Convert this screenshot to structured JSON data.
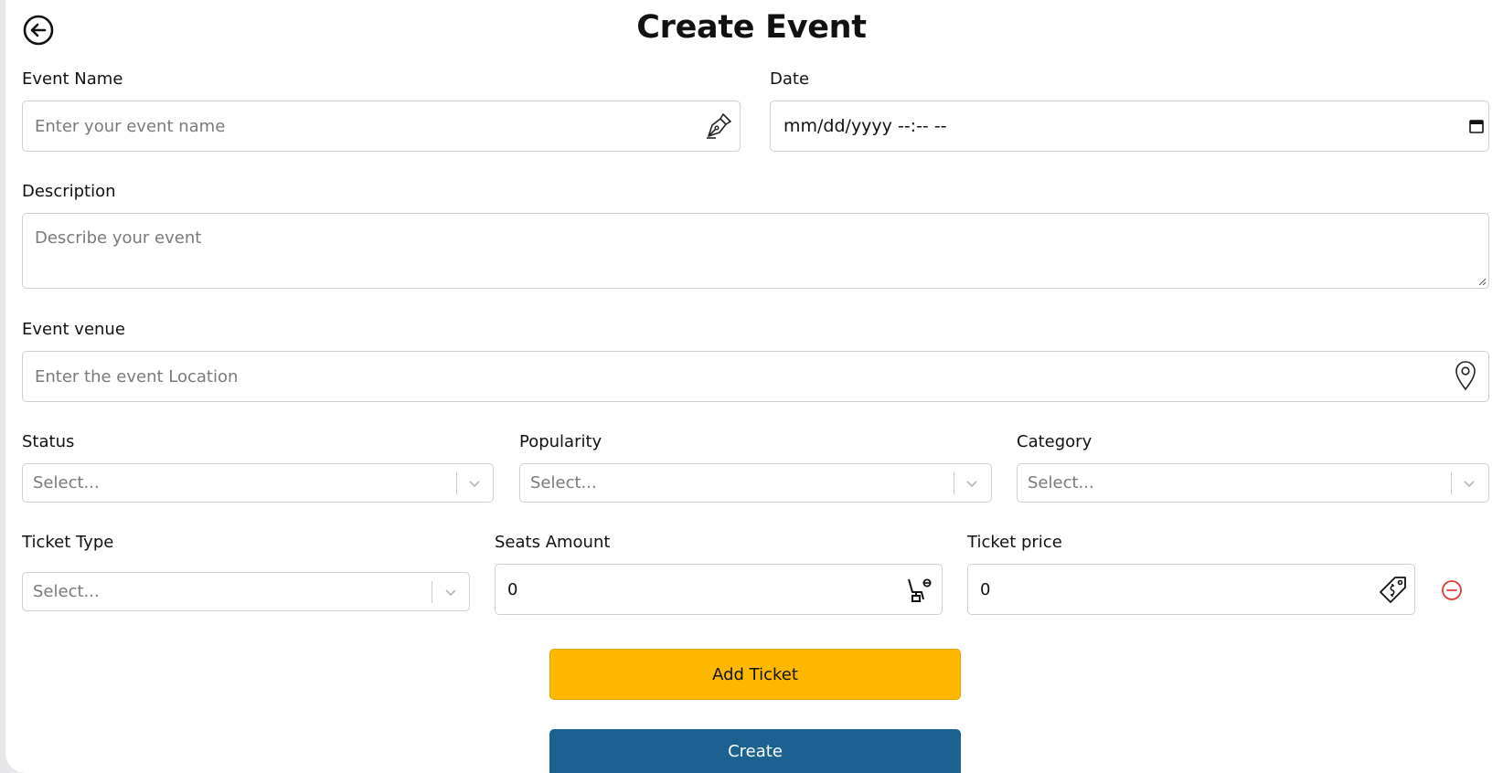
{
  "header": {
    "title": "Create Event"
  },
  "icons": {
    "back": "arrow-left-circle-icon",
    "pen": "fountain-pen-icon",
    "calendar": "calendar-icon",
    "location": "map-pin-icon",
    "seat": "seat-icon",
    "tag": "price-tag-icon",
    "remove": "minus-circle-icon",
    "chevron": "chevron-down-icon"
  },
  "colors": {
    "add_button": "#ffb800",
    "create_button": "#1c6290",
    "remove_icon": "#e53935"
  },
  "form": {
    "event_name": {
      "label": "Event Name",
      "placeholder": "Enter your event name",
      "value": ""
    },
    "date": {
      "label": "Date",
      "value": "mm/dd/yyyy --:-- --"
    },
    "description": {
      "label": "Description",
      "placeholder": "Describe your event",
      "value": ""
    },
    "venue": {
      "label": "Event venue",
      "placeholder": "Enter the event Location",
      "value": ""
    },
    "status": {
      "label": "Status",
      "placeholder": "Select..."
    },
    "popularity": {
      "label": "Popularity",
      "placeholder": "Select..."
    },
    "category": {
      "label": "Category",
      "placeholder": "Select..."
    },
    "ticket_type": {
      "label": "Ticket Type",
      "placeholder": "Select..."
    },
    "seats_amount": {
      "label": "Seats Amount",
      "value": "0"
    },
    "ticket_price": {
      "label": "Ticket price",
      "value": "0"
    }
  },
  "buttons": {
    "add_ticket": "Add Ticket",
    "create": "Create"
  }
}
